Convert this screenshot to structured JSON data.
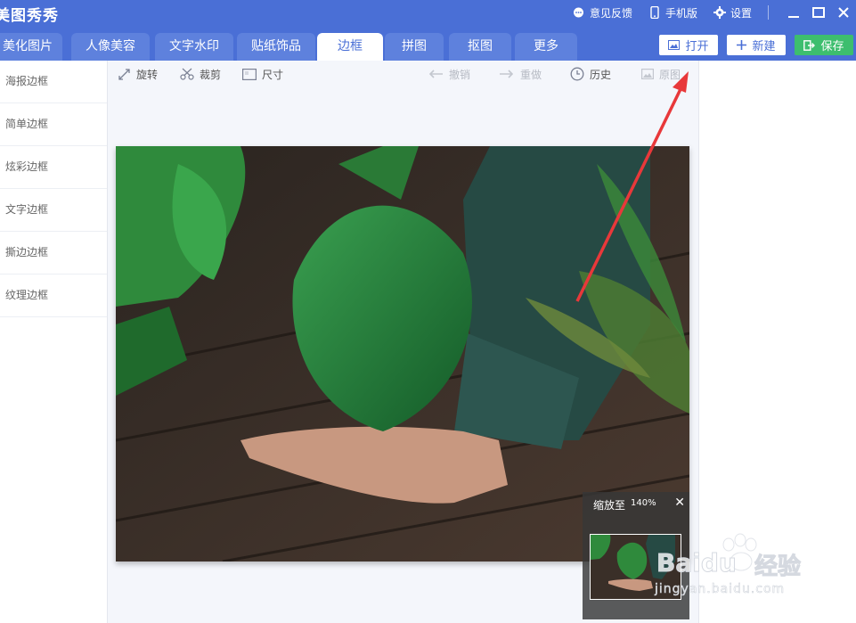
{
  "app": {
    "title": "美图秀秀"
  },
  "top_right": {
    "feedback": "意见反馈",
    "mobile": "手机版",
    "settings": "设置"
  },
  "tabs": [
    {
      "label": "美化图片"
    },
    {
      "label": "人像美容"
    },
    {
      "label": "文字水印"
    },
    {
      "label": "贴纸饰品"
    },
    {
      "label": "边框"
    },
    {
      "label": "拼图"
    },
    {
      "label": "抠图"
    },
    {
      "label": "更多"
    }
  ],
  "actions": {
    "open": "打开",
    "new": "新建",
    "save": "保存"
  },
  "left_panel": {
    "items": [
      {
        "label": "海报边框"
      },
      {
        "label": "简单边框"
      },
      {
        "label": "炫彩边框"
      },
      {
        "label": "文字边框"
      },
      {
        "label": "撕边边框"
      },
      {
        "label": "纹理边框"
      }
    ]
  },
  "toolbar": {
    "rotate": "旋转",
    "crop": "裁剪",
    "size": "尺寸",
    "undo": "撤销",
    "redo": "重做",
    "history": "历史",
    "original": "原图"
  },
  "zoom": {
    "label": "缩放至",
    "value": "140%"
  },
  "watermark": {
    "brand": "Baidu",
    "sub": "经验",
    "url": "jingyan.baidu.com"
  },
  "colors": {
    "header": "#4a6fd6",
    "tab": "#5e81dd",
    "save": "#3dbe6e",
    "arrow": "#e8383a"
  }
}
